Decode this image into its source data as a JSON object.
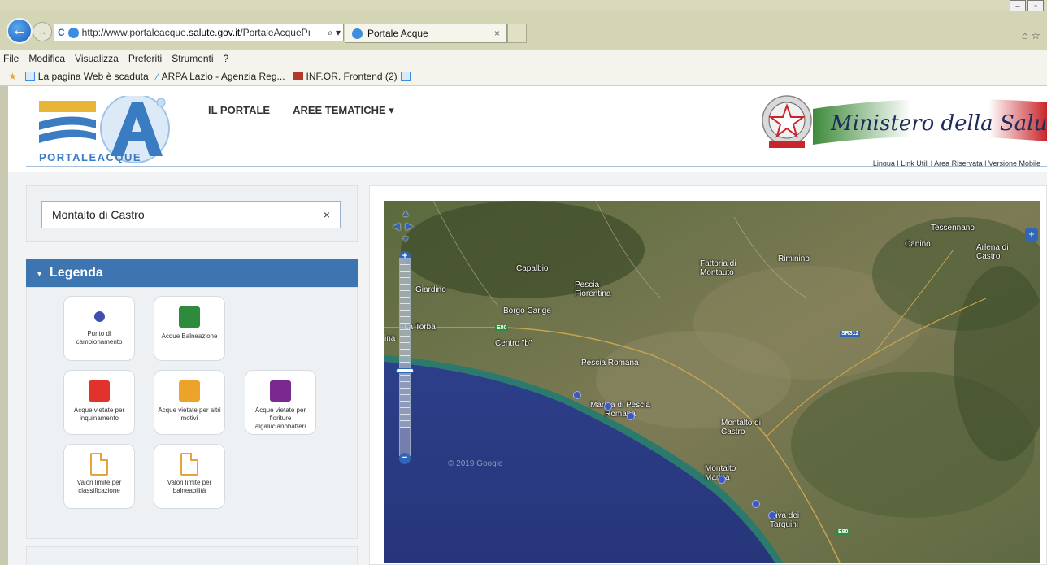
{
  "browser": {
    "url_prefix": "http://www.portaleacque.",
    "url_host": "salute.gov.it",
    "url_path": "/PortaleAcquePı",
    "tab_title": "Portale Acque",
    "tab_close": "×",
    "menu": [
      "File",
      "Modifica",
      "Visualizza",
      "Preferiti",
      "Strumenti",
      "?"
    ],
    "favorites": [
      "La pagina Web è scaduta",
      "ARPA Lazio - Agenzia Reg...",
      "INF.OR. Frontend (2)"
    ]
  },
  "header": {
    "logo_text": "PORTALEACQUE",
    "nav": [
      "IL PORTALE",
      "AREE TEMATICHE ▾"
    ],
    "ministry_text": "Ministero della Salute",
    "utility_links": "Lingua | Link Utili | Area Riservata | Versione Mobile"
  },
  "search": {
    "value": "Montalto di Castro",
    "clear": "×"
  },
  "legend": {
    "title": "Legenda",
    "caret": "▾",
    "items": [
      {
        "label": "Punto di campionamento",
        "color": "#3e4fae",
        "shape": "dot"
      },
      {
        "label": "Acque Balneazione",
        "color": "#2e8b3e",
        "shape": "square"
      },
      {
        "label": "Acque vietate per inquinamento",
        "color": "#e1332b",
        "shape": "square"
      },
      {
        "label": "Acque vietate per altri motivi",
        "color": "#eda32a",
        "shape": "square"
      },
      {
        "label": "Acque vietate per fioriture algali/cianobatteri",
        "color": "#7a2a8e",
        "shape": "square"
      },
      {
        "label": "Valori limite per classificazione",
        "color": "#e3a43a",
        "shape": "document-icon"
      },
      {
        "label": "Valori limite per balneabilità",
        "color": "#e3a43a",
        "shape": "document-icon"
      }
    ]
  },
  "map": {
    "labels": {
      "tessennano": "Tessennano",
      "canino": "Canino",
      "arlena": "Arlena di Castro",
      "capalbio": "Capalbio",
      "fattoria": "Fattoria di Montauto",
      "riminino": "Riminino",
      "giardino": "Giardino",
      "pescia_fiorentina": "Pescia Fiorentina",
      "borgo_carige": "Borgo Carige",
      "la_torba": "La Torba",
      "centro_b": "Centro \"b\"",
      "pescia_romana": "Pescia Romana",
      "marina_pescia": "Marina di Pescia Romana",
      "montalto_castro": "Montalto di Castro",
      "montalto_marina": "Montalto Marina",
      "riva_tarquini": "Riva dei Tarquini",
      "ina": "ina"
    },
    "road_shields": {
      "e80_west": "E80",
      "sr312": "SR312",
      "e80_south": "E80"
    },
    "copyright": "© 2019 Google",
    "sampling_points": 6
  }
}
